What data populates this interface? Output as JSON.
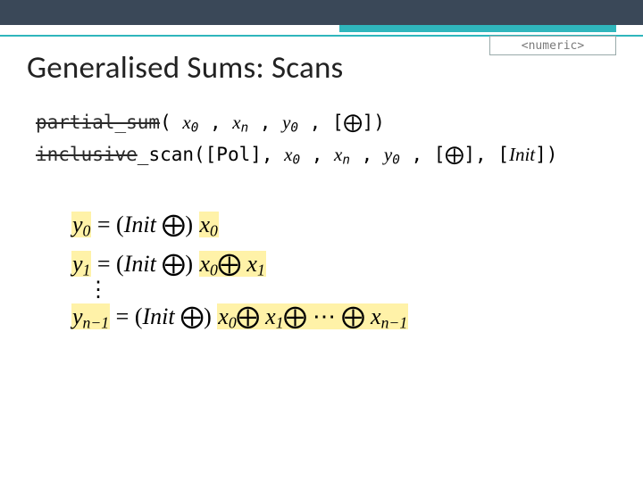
{
  "header": {
    "tag": "<numeric>"
  },
  "title": {
    "text": "Generalised Sums: Scans"
  },
  "funcs": {
    "partial": {
      "name": "partial_sum",
      "open": "( ",
      "a0": "x",
      "s0": "0",
      "c1": " , ",
      "a1": "x",
      "s1": "n",
      "c2": " , ",
      "a2": "y",
      "s2": "0",
      "c3": " , [",
      "op": "⨁",
      "close": "])"
    },
    "inclusive": {
      "pre": "inclusive",
      "suf": "_scan",
      "open": "([Pol], ",
      "a0": "x",
      "s0": "0",
      "c1": " , ",
      "a1": "x",
      "s1": "n",
      "c2": " , ",
      "a2": "y",
      "s2": "0",
      "c3": " , [",
      "op": "⨁",
      "c4": "], [",
      "init": "Init",
      "close": "])"
    }
  },
  "eqs": {
    "r0": {
      "y": "y",
      "ys": "0",
      "eq": " = (",
      "init": "Init ",
      "op1": "⨁",
      "cp": ") ",
      "x0": "x",
      "xs0": "0"
    },
    "r1": {
      "y": "y",
      "ys": "1",
      "eq": " = (",
      "init": "Init ",
      "op1": "⨁",
      "cp": ") ",
      "x0": "x",
      "xs0": "0",
      "op2": "⨁ ",
      "x1": "x",
      "xs1": "1"
    },
    "dots": "⋮",
    "rn": {
      "y": "y",
      "ys": "n−1",
      "eq": " = (",
      "init": "Init ",
      "op1": "⨁",
      "cp": ") ",
      "x0": "x",
      "xs0": "0",
      "op2": "⨁ ",
      "x1": "x",
      "xs1": "1",
      "op3": "⨁ ⋯ ⨁ ",
      "xn": "x",
      "xsn": "n−1"
    }
  }
}
